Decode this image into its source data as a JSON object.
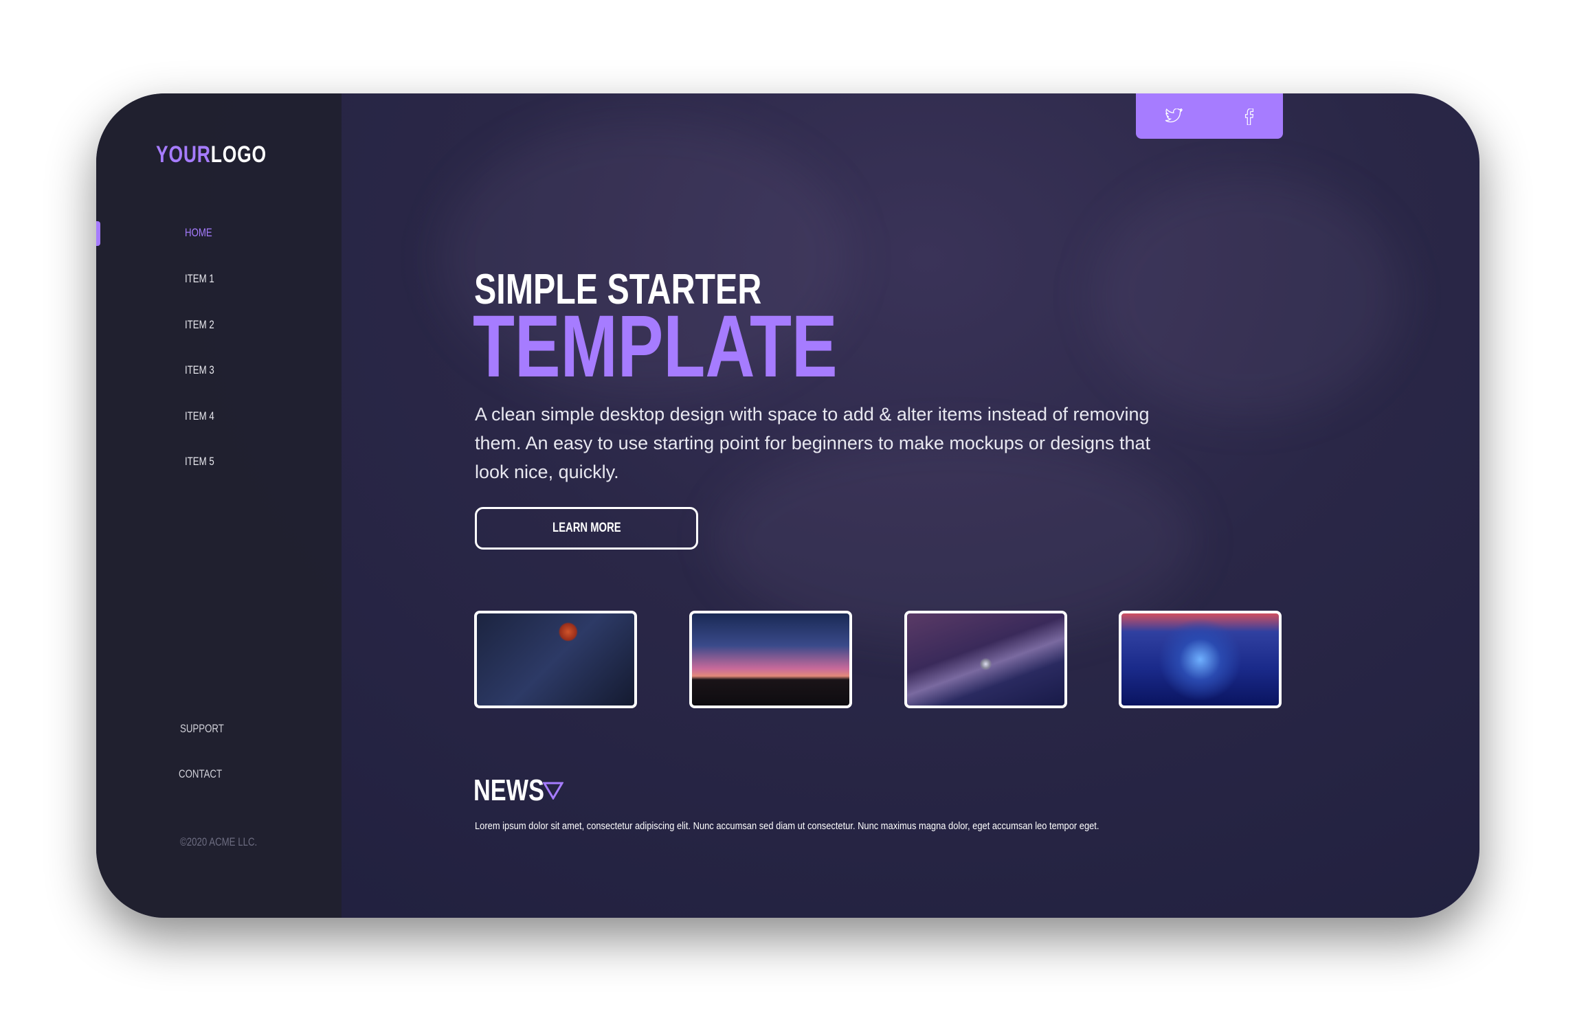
{
  "brand": {
    "logo_part1": "YOUR",
    "logo_part2": "LOGO",
    "accent": "#a67cff"
  },
  "nav": {
    "items": [
      {
        "label": "HOME",
        "active": true
      },
      {
        "label": "ITEM 1"
      },
      {
        "label": "ITEM 2"
      },
      {
        "label": "ITEM 3"
      },
      {
        "label": "ITEM 4"
      },
      {
        "label": "ITEM  5"
      }
    ]
  },
  "footer": {
    "support": "SUPPORT",
    "contact": "CONTACT",
    "copyright": "©2020 ACME LLC."
  },
  "social": {
    "icons": [
      "twitter-icon",
      "facebook-icon"
    ]
  },
  "hero": {
    "title_line1": "SIMPLE STARTER",
    "title_line2": "TEMPLATE",
    "description": "A clean simple desktop design with space to add & alter items instead of removing them. An easy to use starting point for beginners to make mockups or designs that look nice, quickly.",
    "button": "LEARN MORE"
  },
  "gallery": [
    "night-sky-moon",
    "mountain-sunset-sky",
    "astronaut-snow",
    "robot-neon"
  ],
  "news": {
    "title": "NEWS",
    "text": "Lorem ipsum dolor sit amet, consectetur adipiscing elit. Nunc accumsan sed diam ut consectetur. Nunc maximus magna dolor, eget accumsan leo tempor eget."
  }
}
